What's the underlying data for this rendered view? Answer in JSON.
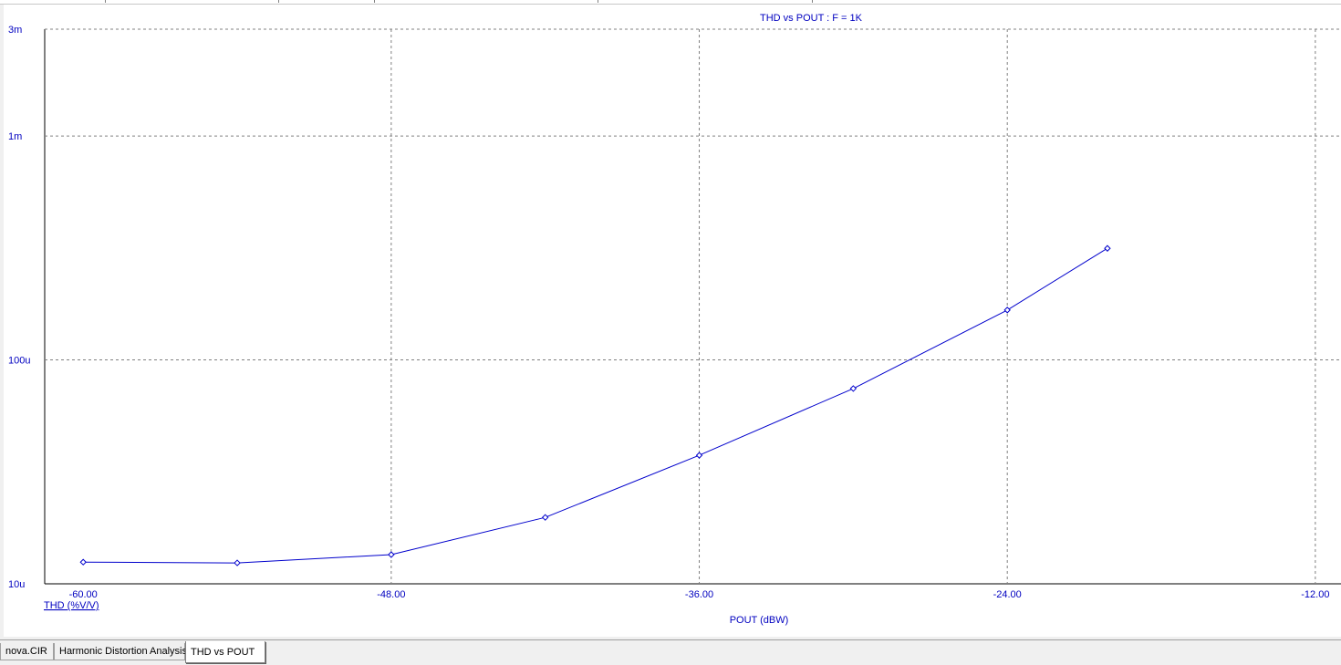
{
  "colors": {
    "axis_text": "#0000c0",
    "series_line": "#0000cc",
    "grid": "#808080",
    "border": "#000000"
  },
  "chart_data": {
    "type": "line",
    "title": "THD vs POUT : F = 1K",
    "xlabel": "POUT (dBW)",
    "ylabel": "THD (%V/V)",
    "xscale": "linear",
    "yscale": "log",
    "xlim": [
      -61.5,
      -11.0
    ],
    "ylim": [
      1e-05,
      0.003
    ],
    "x_ticks": [
      -60.0,
      -48.0,
      -36.0,
      -24.0,
      -12.0
    ],
    "x_tick_labels": [
      "-60.00",
      "-48.00",
      "-36.00",
      "-24.00",
      "-12.00"
    ],
    "y_ticks": [
      1e-05,
      0.0001,
      0.001,
      0.003
    ],
    "y_tick_labels": [
      "10u",
      "100u",
      "1m",
      "3m"
    ],
    "grid": true,
    "series": [
      {
        "x": [
          -60.0,
          -54.0,
          -48.0,
          -42.0,
          -36.0,
          -30.0,
          -24.0,
          -20.1
        ],
        "y": [
          1.25e-05,
          1.24e-05,
          1.35e-05,
          1.98e-05,
          3.75e-05,
          7.45e-05,
          0.000167,
          0.000315
        ],
        "marker": "diamond"
      }
    ]
  },
  "tabs": [
    {
      "label": "nova.CIR",
      "active": false
    },
    {
      "label": "Harmonic Distortion Analysis",
      "active": false
    },
    {
      "label": "THD vs POUT",
      "active": true
    }
  ]
}
